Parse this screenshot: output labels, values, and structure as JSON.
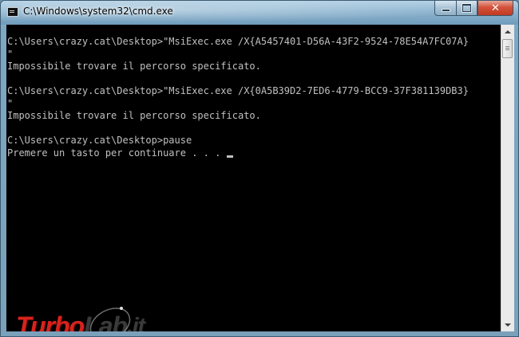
{
  "window": {
    "title": "C:\\Windows\\system32\\cmd.exe",
    "icon": "cmd-console-icon",
    "caption_buttons": {
      "minimize_icon": "minimize-icon",
      "maximize_icon": "maximize-icon",
      "close_symbol": "✕"
    }
  },
  "console": {
    "lines": [
      "C:\\Users\\crazy.cat\\Desktop>\"MsiExec.exe /X{A5457401-D56A-43F2-9524-78E54A7FC07A}",
      "\"",
      "Impossibile trovare il percorso specificato.",
      "",
      "C:\\Users\\crazy.cat\\Desktop>\"MsiExec.exe /X{0A5B39D2-7ED6-4779-BCC9-37F381139DB3}",
      "\"",
      "Impossibile trovare il percorso specificato.",
      "",
      "C:\\Users\\crazy.cat\\Desktop>pause",
      "Premere un tasto per continuare . . ."
    ],
    "text_color": "#c0c0c0",
    "background_color": "#000000"
  },
  "watermark": {
    "part1": "Turbo",
    "part2": "Lab",
    "part3": ".it",
    "accent_color": "#d8231c"
  }
}
